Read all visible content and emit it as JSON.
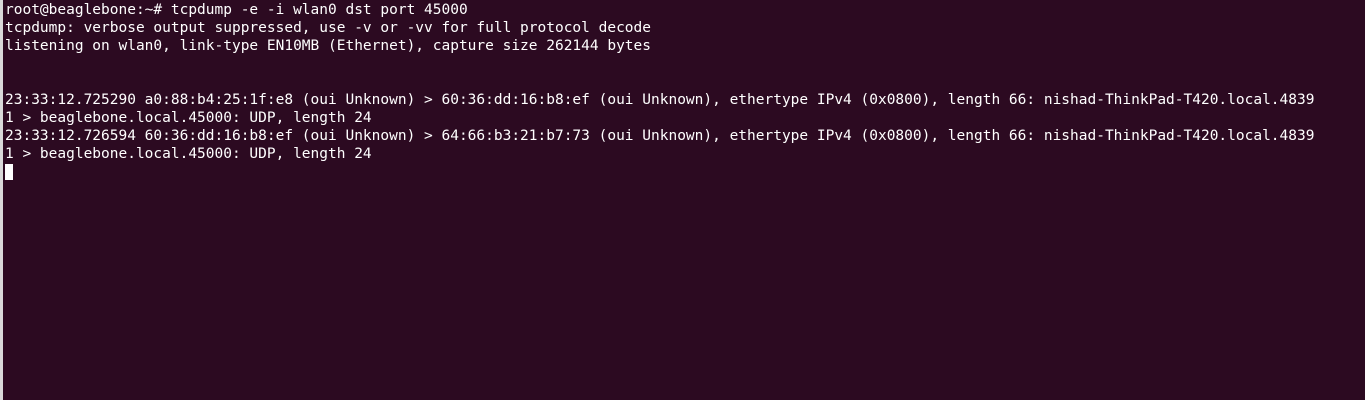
{
  "terminal": {
    "lines": [
      "root@beaglebone:~# tcpdump -e -i wlan0 dst port 45000",
      "tcpdump: verbose output suppressed, use -v or -vv for full protocol decode",
      "listening on wlan0, link-type EN10MB (Ethernet), capture size 262144 bytes",
      "",
      "",
      "23:33:12.725290 a0:88:b4:25:1f:e8 (oui Unknown) > 60:36:dd:16:b8:ef (oui Unknown), ethertype IPv4 (0x0800), length 66: nishad-ThinkPad-T420.local.4839",
      "1 > beaglebone.local.45000: UDP, length 24",
      "23:33:12.726594 60:36:dd:16:b8:ef (oui Unknown) > 64:66:b3:21:b7:73 (oui Unknown), ethertype IPv4 (0x0800), length 66: nishad-ThinkPad-T420.local.4839",
      "1 > beaglebone.local.45000: UDP, length 24"
    ]
  },
  "colors": {
    "background": "#2c0a21",
    "foreground": "#ffffff"
  }
}
